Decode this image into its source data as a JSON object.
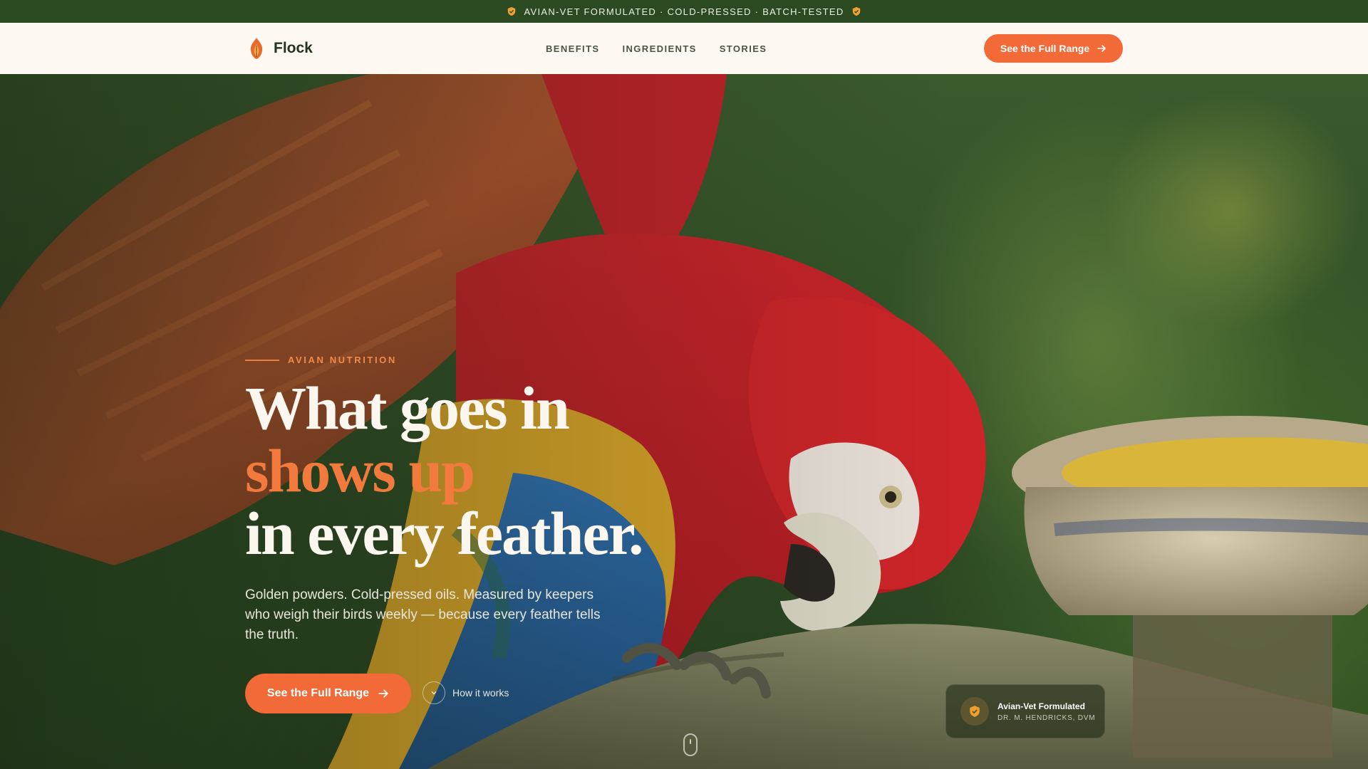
{
  "announcement": {
    "text": "AVIAN-VET FORMULATED · COLD-PRESSED · BATCH-TESTED",
    "icon": "shield-icon"
  },
  "nav": {
    "brand": "Flock",
    "logo_icon": "flame-feather-icon",
    "links": [
      "BENEFITS",
      "INGREDIENTS",
      "STORIES"
    ],
    "cta": "See the Full Range"
  },
  "hero": {
    "eyebrow": "AVIAN NUTRITION",
    "headline": {
      "line1": "What goes in",
      "line2": "shows up",
      "line3": "in every feather."
    },
    "subtext": "Golden powders. Cold-pressed oils. Measured by keepers who weigh their birds weekly — because every feather tells the truth.",
    "primary_cta": "See the Full Range",
    "secondary_cta": "How it works"
  },
  "badge": {
    "title": "Avian-Vet Formulated",
    "subtitle": "DR. M. HENDRICKS, DVM",
    "icon": "shield-icon"
  },
  "colors": {
    "accent": "#f26a38",
    "top_strip": "#2c4a22",
    "nav_bg": "#fdf8f1",
    "headline": "#fbf6ee"
  }
}
